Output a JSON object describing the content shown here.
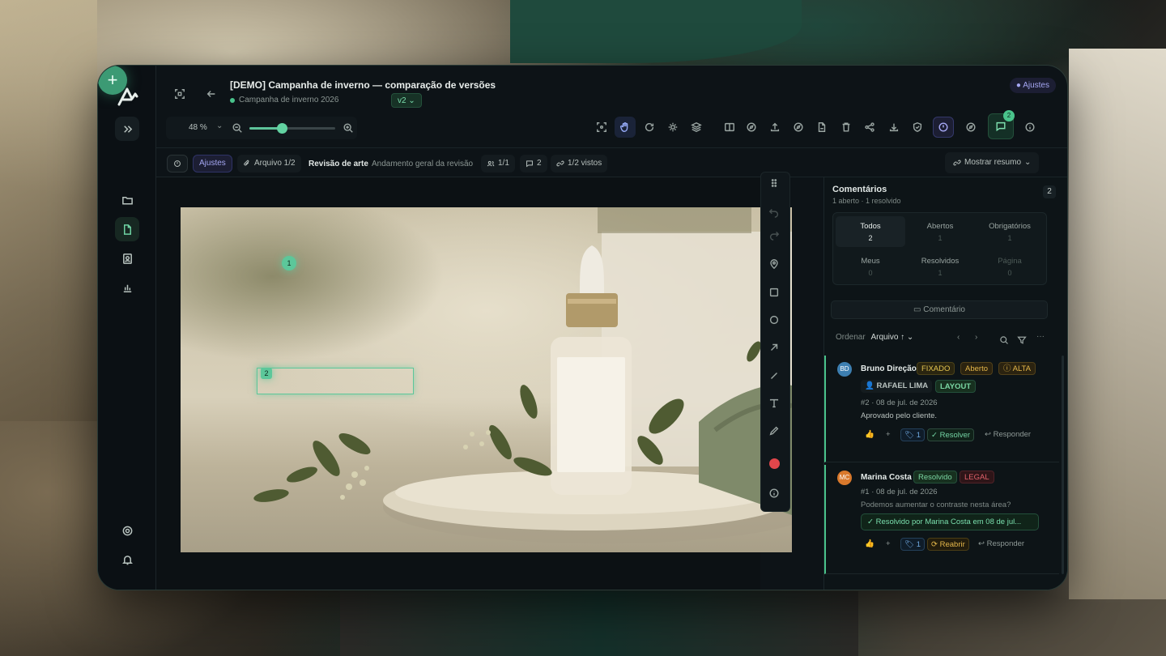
{
  "header": {
    "title": "[DEMO] Campanha de inverno — comparação de versões",
    "project": "Campanha de inverno 2026",
    "version": "v2",
    "status_pill": "Ajustes"
  },
  "zoom": {
    "value": "48 %",
    "level": 0.38
  },
  "subbar": {
    "status": "Ajustes",
    "file": "Arquivo 1/2",
    "stage": "Revisão de arte",
    "stage_desc": "Andamento geral da revisão",
    "reviewers": "1/1",
    "comments": "2",
    "views": "1/2 vistos",
    "summary_button": "Mostrar resumo"
  },
  "canvas": {
    "pins": [
      "1",
      "2"
    ]
  },
  "panel": {
    "title": "Comentários",
    "subtitle": "1 aberto · 1 resolvido",
    "count": "2",
    "filters": [
      {
        "label": "Todos",
        "n": "2"
      },
      {
        "label": "Abertos",
        "n": "1"
      },
      {
        "label": "Obrigatórios",
        "n": "1"
      },
      {
        "label": "Meus",
        "n": "0"
      },
      {
        "label": "Resolvidos",
        "n": "1"
      },
      {
        "label": "Página",
        "n": "0"
      }
    ],
    "comment_button": "Comentário",
    "sort_label": "Ordenar",
    "sort_value": "Arquivo ↑"
  },
  "comments": [
    {
      "initials": "BD",
      "author": "Bruno Direção",
      "tags": [
        "FIXADO",
        "Aberto",
        "ALTA"
      ],
      "assignee": "RAFAEL LIMA",
      "category": "LAYOUT",
      "meta": "#2 · 08 de jul. de 2026",
      "text": "Aprovado pelo cliente.",
      "plus": "+",
      "tag_count": "1",
      "action": "Resolver",
      "reply": "Responder"
    },
    {
      "initials": "MC",
      "author": "Marina Costa",
      "tags": [
        "Resolvido",
        "LEGAL"
      ],
      "meta": "#1 · 08 de jul. de 2026",
      "text": "Podemos aumentar o contraste nesta área?",
      "resolved_note": "Resolvido por Marina Costa em 08 de jul...",
      "plus": "+",
      "tag_count": "1",
      "action": "Reabrir",
      "reply": "Responder"
    }
  ],
  "colors": {
    "accent": "#49c38b",
    "panel_bg": "#0d1417",
    "warning": "#e3b64a",
    "danger": "#e0606a"
  }
}
